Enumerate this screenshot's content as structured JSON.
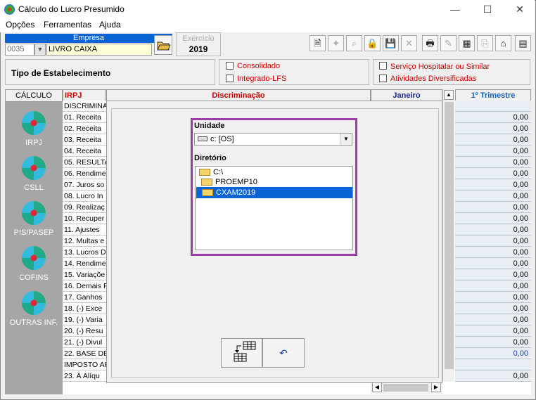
{
  "window": {
    "title": "Cálculo do Lucro Presumido",
    "minimize": "—",
    "maximize": "☐",
    "close": "✕"
  },
  "menu": [
    "Opções",
    "Ferramentas",
    "Ajuda"
  ],
  "empresa": {
    "label": "Empresa",
    "code": "0035",
    "name": "LIVRO CAIXA"
  },
  "exercicio": {
    "label": "Exercício",
    "year": "2019"
  },
  "tipo_estabelecimento": "Tipo de Estabelecimento",
  "checkboxes": [
    "Consolidado",
    "Integrado-LFS",
    "Serviço Hospitalar ou Similar",
    "Atividades Diversificadas"
  ],
  "sidebar": {
    "header": "CÁLCULO",
    "items": [
      "IRPJ",
      "CSLL",
      "PIS/PASEP",
      "COFINS",
      "OUTRAS INF."
    ]
  },
  "grid": {
    "col_irpj": "IRPJ",
    "col_disc": "Discriminação",
    "col_janeiro": "Janeiro",
    "col_trimestre": "1º Trimestre",
    "rows": [
      "DISCRIMINA",
      "01. Receita",
      "02. Receita",
      "03. Receita",
      "04. Receita",
      "05. RESULTA",
      "06. Rendime",
      "07. Juros so",
      "08. Lucro In",
      "09. Realizaç",
      "10. Recuper",
      "11. Ajustes",
      "12. Multas e",
      "13. Lucros D",
      "14. Rendime",
      "15. Variaçõe",
      "16. Demais F",
      "17. Ganhos",
      "18. (-) Exce",
      "19. (-) Varia",
      "20. (-) Resu",
      "21. (-) Divul",
      "22. BASE DE",
      "IMPOSTO AP",
      "23. À Alíqu"
    ],
    "values": [
      "",
      "0,00",
      "0,00",
      "0,00",
      "0,00",
      "0,00",
      "0,00",
      "0,00",
      "0,00",
      "0,00",
      "0,00",
      "0,00",
      "0,00",
      "0,00",
      "0,00",
      "0,00",
      "0,00",
      "0,00",
      "0,00",
      "0,00",
      "0,00",
      "0,00",
      "0,00",
      "",
      "0,00"
    ]
  },
  "dialog": {
    "unidade_label": "Unidade",
    "drive": "c: [OS]",
    "diretorio_label": "Diretório",
    "dirs": [
      "C:\\",
      "PROEMP10",
      "CXAM2019"
    ]
  }
}
